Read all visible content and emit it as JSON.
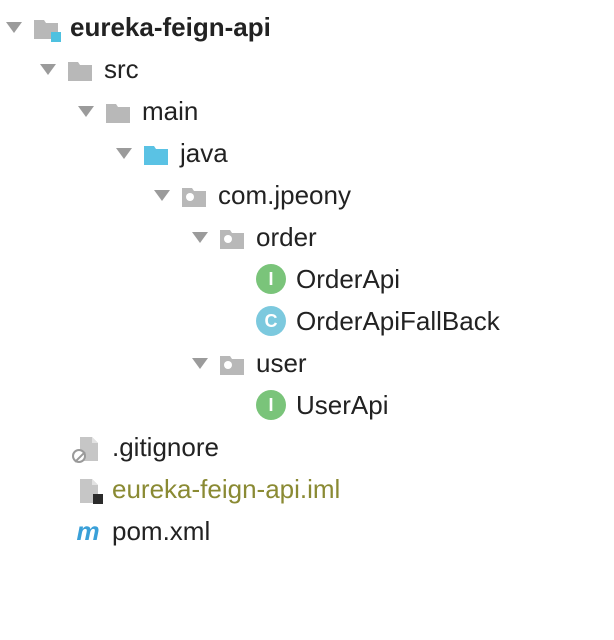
{
  "tree": {
    "root": "eureka-feign-api",
    "src": "src",
    "main": "main",
    "java": "java",
    "pkg": "com.jpeony",
    "order": "order",
    "orderApi": "OrderApi",
    "orderApiFallBack": "OrderApiFallBack",
    "user": "user",
    "userApi": "UserApi",
    "gitignore": ".gitignore",
    "iml": "eureka-feign-api.iml",
    "pom": "pom.xml"
  },
  "iconLetters": {
    "interface": "I",
    "class": "C"
  }
}
